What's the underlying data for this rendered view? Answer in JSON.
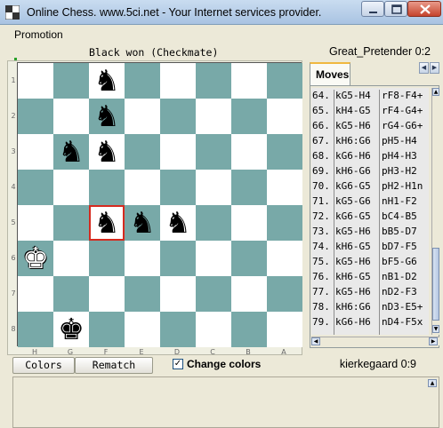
{
  "window": {
    "title": "Online Chess.   www.5ci.net - Your Internet services provider."
  },
  "menu": {
    "items": [
      "Promotion"
    ]
  },
  "game": {
    "status": "Black won (Checkmate)",
    "top_player": "Great_Pretender 0:2",
    "bottom_player": "kierkegaard 0:9"
  },
  "board": {
    "files": [
      "H",
      "G",
      "F",
      "E",
      "D",
      "C",
      "B",
      "A"
    ],
    "ranks": [
      "1",
      "2",
      "3",
      "4",
      "5",
      "6",
      "7",
      "8"
    ],
    "highlight_square": "F5",
    "pieces": [
      {
        "square": "F1",
        "piece": "knight",
        "color": "black"
      },
      {
        "square": "F2",
        "piece": "knight",
        "color": "black"
      },
      {
        "square": "G3",
        "piece": "knight",
        "color": "black"
      },
      {
        "square": "F3",
        "piece": "knight",
        "color": "black"
      },
      {
        "square": "F5",
        "piece": "knight",
        "color": "black"
      },
      {
        "square": "E5",
        "piece": "knight",
        "color": "black"
      },
      {
        "square": "D5",
        "piece": "knight",
        "color": "black"
      },
      {
        "square": "H6",
        "piece": "king",
        "color": "white"
      },
      {
        "square": "G8",
        "piece": "king",
        "color": "black"
      }
    ]
  },
  "moves_panel": {
    "tab_label": "Moves",
    "moves": [
      {
        "num": "64.",
        "white": "kG5-H4",
        "black": "rF8-F4+"
      },
      {
        "num": "65.",
        "white": "kH4-G5",
        "black": "rF4-G4+"
      },
      {
        "num": "66.",
        "white": "kG5-H6",
        "black": "rG4-G6+"
      },
      {
        "num": "67.",
        "white": "kH6:G6",
        "black": "pH5-H4"
      },
      {
        "num": "68.",
        "white": "kG6-H6",
        "black": "pH4-H3"
      },
      {
        "num": "69.",
        "white": "kH6-G6",
        "black": "pH3-H2"
      },
      {
        "num": "70.",
        "white": "kG6-G5",
        "black": "pH2-H1n"
      },
      {
        "num": "71.",
        "white": "kG5-G6",
        "black": "nH1-F2"
      },
      {
        "num": "72.",
        "white": "kG6-G5",
        "black": "bC4-B5"
      },
      {
        "num": "73.",
        "white": "kG5-H6",
        "black": "bB5-D7"
      },
      {
        "num": "74.",
        "white": "kH6-G5",
        "black": "bD7-F5"
      },
      {
        "num": "75.",
        "white": "kG5-H6",
        "black": "bF5-G6"
      },
      {
        "num": "76.",
        "white": "kH6-G5",
        "black": "nB1-D2"
      },
      {
        "num": "77.",
        "white": "kG5-H6",
        "black": "nD2-F3"
      },
      {
        "num": "78.",
        "white": "kH6:G6",
        "black": "nD3-E5+"
      },
      {
        "num": "79.",
        "white": "kG6-H6",
        "black": "nD4-F5x"
      }
    ]
  },
  "controls": {
    "colors_button": "Colors",
    "rematch_button": "Rematch",
    "change_colors_label": "Change colors",
    "change_colors_checked": true
  },
  "theme": {
    "light_square": "#ffffff",
    "dark_square": "#78a9a8",
    "highlight": "#d52a1f"
  }
}
